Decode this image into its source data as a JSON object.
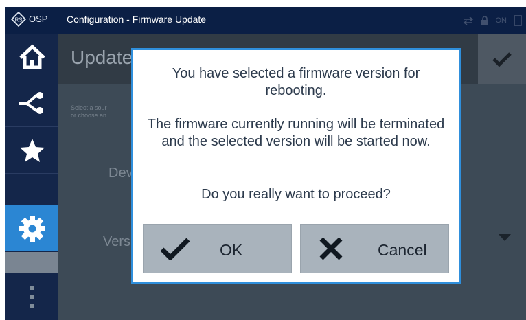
{
  "titlebar": {
    "logo_text": "OSP",
    "title": "Configuration - Firmware Update",
    "status_text": "ON"
  },
  "sidebar": {
    "items": [
      {
        "icon": "home-icon",
        "active": false
      },
      {
        "icon": "connection-icon",
        "active": false
      },
      {
        "icon": "star-icon",
        "active": false
      },
      {
        "icon": "gear-icon",
        "active": true
      },
      {
        "icon": "more-vertical-icon",
        "active": false
      }
    ]
  },
  "background": {
    "header_title": "Update",
    "hint_line1": "Select a sour",
    "hint_line2": "or choose an",
    "device_label": "Dev",
    "version_label": "Versi"
  },
  "dialog": {
    "message1": "You have selected a firmware version for rebooting.",
    "message2": "The firmware currently running will be terminated and the selected version will be started now.",
    "question": "Do you really want to proceed?",
    "ok_label": "OK",
    "cancel_label": "Cancel"
  },
  "colors": {
    "titlebar": "#0b1f45",
    "sidebar": "#14264a",
    "active_nav": "#2b86d3",
    "dialog_border": "#2f8fdc",
    "button": "#a9b3bc"
  }
}
